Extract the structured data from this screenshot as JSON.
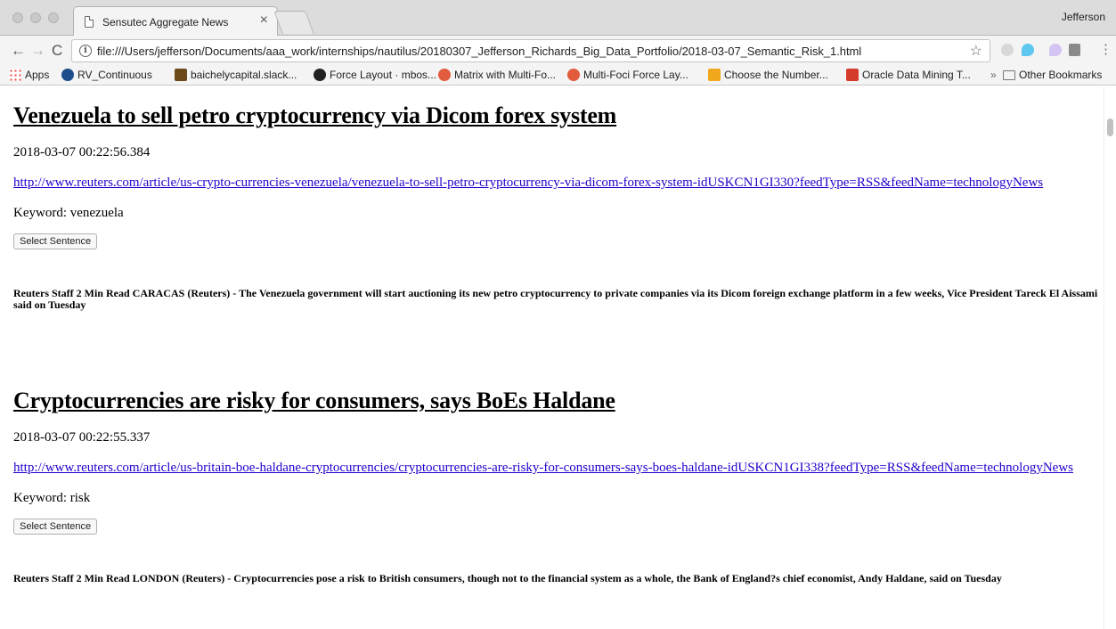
{
  "browser": {
    "tab_title": "Sensutec Aggregate News",
    "tab_close": "×",
    "profile_name": "Jefferson",
    "url": "file:///Users/jefferson/Documents/aaa_work/internships/nautilus/20180307_Jefferson_Richards_Big_Data_Portfolio/2018-03-07_Semantic_Risk_1.html",
    "nav": {
      "back": "←",
      "forward": "→",
      "reload": "C",
      "info": "i",
      "star": "☆",
      "menu": "⋮"
    }
  },
  "bookmarks": [
    {
      "label": "Apps",
      "icon": "apps-icon"
    },
    {
      "label": "RV_Continuous",
      "icon": "rv-icon"
    },
    {
      "label": "baichelycapital.slack...",
      "icon": "slack-icon"
    },
    {
      "label": "Force Layout · mbos...",
      "icon": "github-icon"
    },
    {
      "label": "Matrix with Multi-Fo...",
      "icon": "matrix-icon"
    },
    {
      "label": "Multi-Foci Force Lay...",
      "icon": "matrix-icon"
    },
    {
      "label": "Choose the Number...",
      "icon": "cube-icon"
    },
    {
      "label": "Oracle Data Mining T...",
      "icon": "oracle-icon"
    }
  ],
  "bookmarks_overflow": "»",
  "other_bookmarks": "Other Bookmarks",
  "articles": [
    {
      "headline": "Venezuela to sell petro cryptocurrency via Dicom forex system",
      "timestamp": "2018-03-07 00:22:56.384",
      "link": "http://www.reuters.com/article/us-crypto-currencies-venezuela/venezuela-to-sell-petro-cryptocurrency-via-dicom-forex-system-idUSKCN1GI330?feedType=RSS&feedName=technologyNews",
      "keyword": "Keyword: venezuela",
      "button": "Select Sentence",
      "summary": "Reuters Staff 2 Min Read CARACAS (Reuters) - The Venezuela government will start auctioning its new petro cryptocurrency to private companies via its Dicom foreign exchange platform in a few weeks, Vice President Tareck El Aissami said on Tuesday"
    },
    {
      "headline": "Cryptocurrencies are risky for consumers, says BoEs Haldane",
      "timestamp": "2018-03-07 00:22:55.337",
      "link": "http://www.reuters.com/article/us-britain-boe-haldane-cryptocurrencies/cryptocurrencies-are-risky-for-consumers-says-boes-haldane-idUSKCN1GI338?feedType=RSS&feedName=technologyNews",
      "keyword": "Keyword: risk",
      "button": "Select Sentence",
      "summary": "Reuters Staff 2 Min Read LONDON (Reuters) - Cryptocurrencies pose a risk to British consumers, though not to the financial system as a whole, the Bank of England?s chief economist, Andy Haldane, said on Tuesday"
    }
  ]
}
